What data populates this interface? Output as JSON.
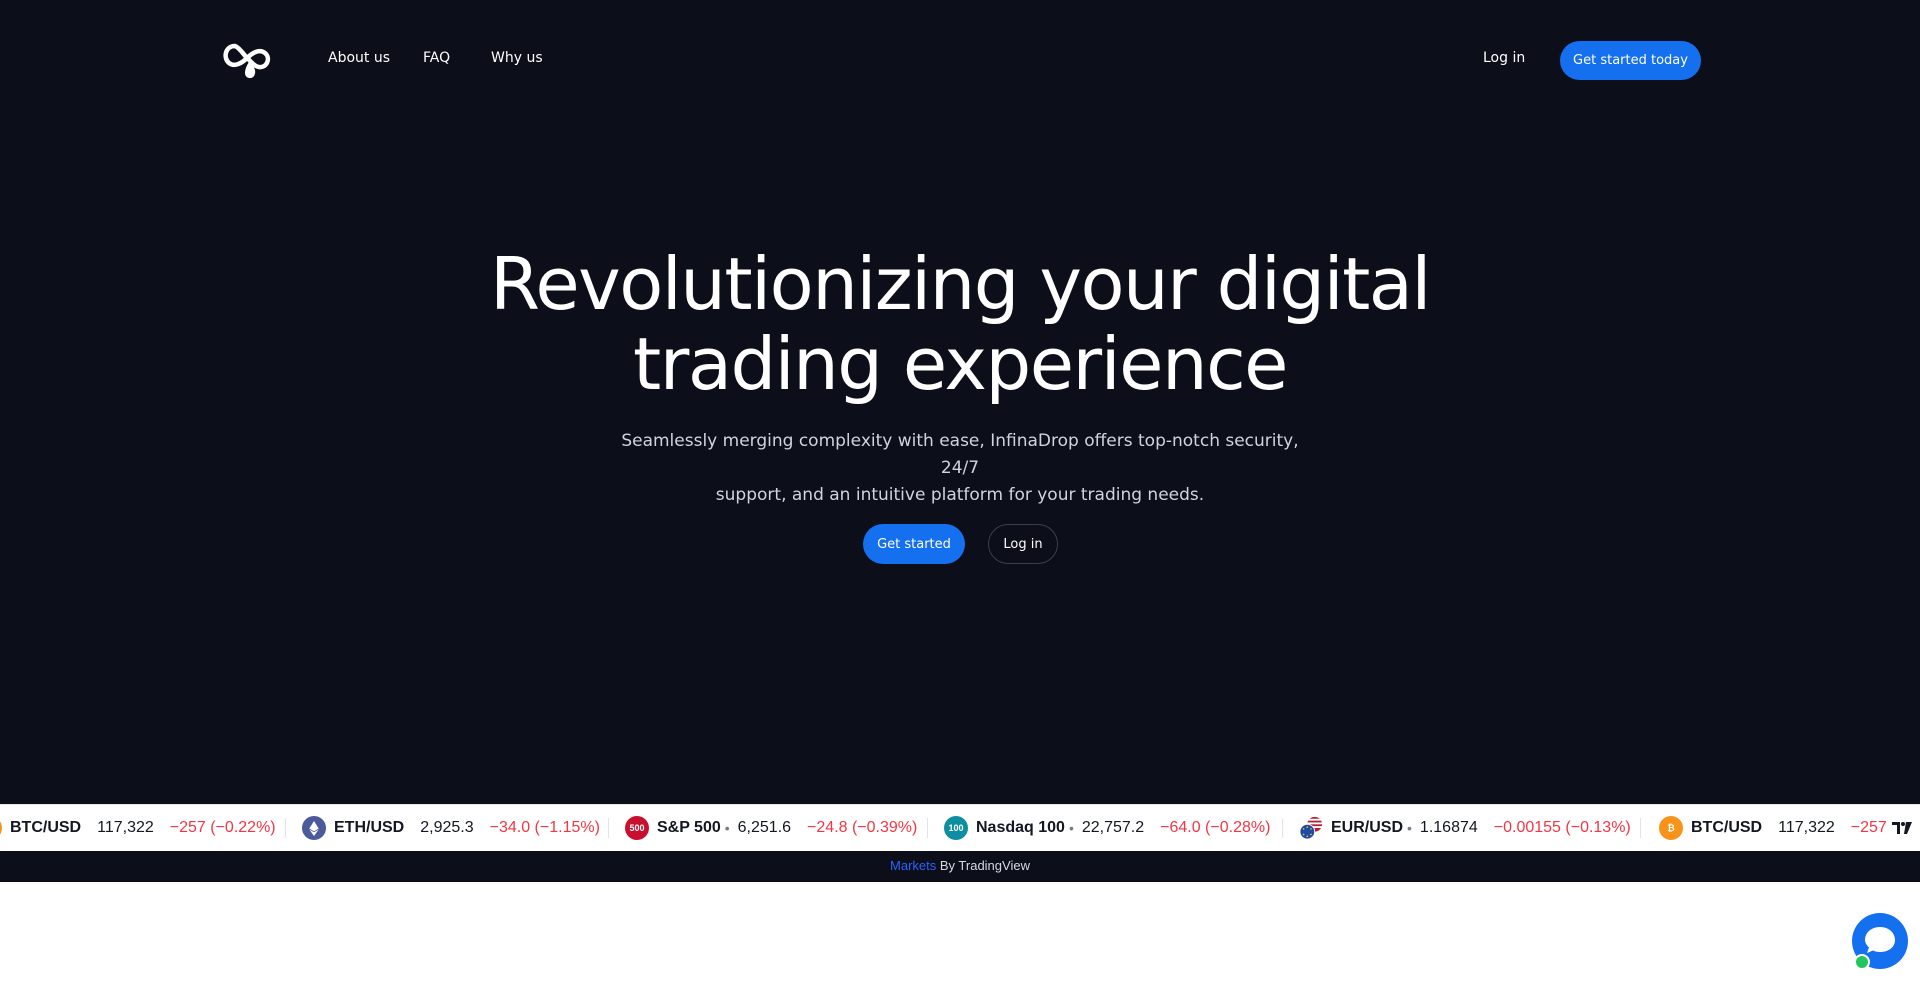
{
  "nav": {
    "logo": "infinadrop-logo-icon",
    "links": [
      {
        "label": "About us"
      },
      {
        "label": "FAQ"
      },
      {
        "label": "Why us"
      }
    ],
    "login_label": "Log in",
    "cta_label": "Get started today"
  },
  "hero": {
    "headline_line1": "Revolutionizing your digital",
    "headline_line2": "trading experience",
    "subtext_line1": "Seamlessly merging complexity with ease, InfinaDrop offers top-notch security, 24/7",
    "subtext_line2": "support, and an intuitive platform for your trading needs.",
    "primary_label": "Get started",
    "secondary_label": "Log in"
  },
  "ticker": {
    "items": [
      {
        "symbol": "BTC/USD",
        "price": "117,322",
        "change": "−257 (−0.22%)",
        "icon": "bitcoin-icon",
        "color": "#f7931a"
      },
      {
        "symbol": "ETH/USD",
        "price": "2,925.3",
        "change": "−34.0 (−1.15%)",
        "icon": "ethereum-icon",
        "color": "#4b5a9a"
      },
      {
        "symbol": "S&P 500",
        "price": "6,251.6",
        "change": "−24.8 (−0.39%)",
        "icon": "sp500-icon",
        "icon_text": "500",
        "color": "#c8102e",
        "dot": "•"
      },
      {
        "symbol": "Nasdaq 100",
        "price": "22,757.2",
        "change": "−64.0 (−0.28%)",
        "icon": "nasdaq-icon",
        "icon_text": "100",
        "color": "#0d8ea3",
        "dot": "•"
      },
      {
        "symbol": "EUR/USD",
        "price": "1.16874",
        "change": "−0.00155 (−0.13%)",
        "icon": "eur-usd-flag-icon",
        "color": "#1e4aa8",
        "dot": "•"
      },
      {
        "symbol": "BTC/USD",
        "price": "117,322",
        "change": "−257 (",
        "icon": "bitcoin-icon",
        "color": "#f7931a"
      }
    ],
    "change_color": "#f23645"
  },
  "attribution": {
    "link": "Markets",
    "text": " By TradingView"
  },
  "colors": {
    "background": "#0c0e1a",
    "accent": "#1570ef"
  }
}
